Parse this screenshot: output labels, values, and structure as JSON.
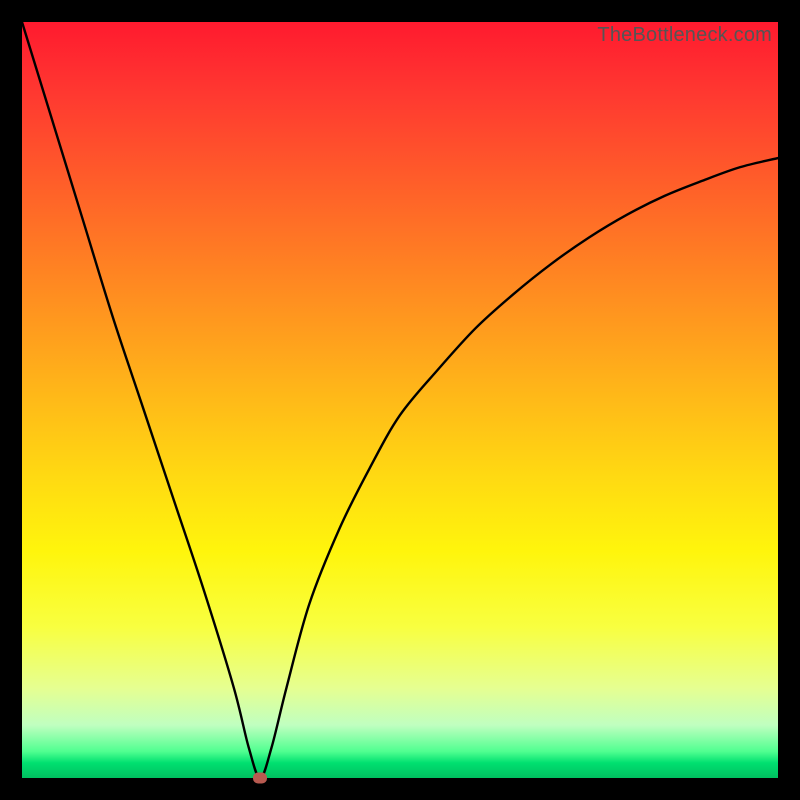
{
  "attribution": "TheBottleneck.com",
  "colors": {
    "frame": "#000000",
    "curve": "#000000",
    "marker": "#b85a50"
  },
  "chart_data": {
    "type": "line",
    "title": "",
    "xlabel": "",
    "ylabel": "",
    "xlim": [
      0,
      100
    ],
    "ylim": [
      0,
      100
    ],
    "grid": false,
    "legend": false,
    "series": [
      {
        "name": "bottleneck-curve",
        "x": [
          0,
          4,
          8,
          12,
          16,
          20,
          24,
          28,
          30,
          31.5,
          33,
          35,
          38,
          42,
          46,
          50,
          55,
          60,
          65,
          70,
          75,
          80,
          85,
          90,
          95,
          100
        ],
        "y": [
          100,
          87,
          74,
          61,
          49,
          37,
          25,
          12,
          4,
          0,
          4,
          12,
          23,
          33,
          41,
          48,
          54,
          59.5,
          64,
          68,
          71.5,
          74.5,
          77,
          79,
          80.8,
          82
        ]
      }
    ],
    "marker": {
      "x": 31.5,
      "y": 0
    },
    "background_gradient": {
      "orientation": "vertical",
      "stops": [
        {
          "pos": 0.0,
          "color": "#ff1a2f"
        },
        {
          "pos": 0.5,
          "color": "#ffba18"
        },
        {
          "pos": 0.8,
          "color": "#f8ff40"
        },
        {
          "pos": 0.97,
          "color": "#50ff90"
        },
        {
          "pos": 1.0,
          "color": "#00c060"
        }
      ]
    }
  }
}
